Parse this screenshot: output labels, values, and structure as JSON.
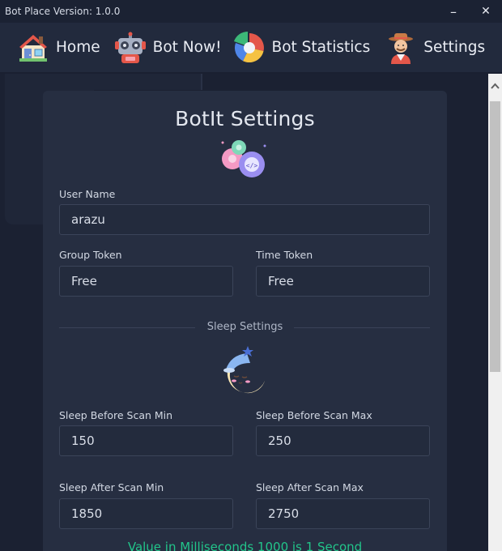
{
  "window": {
    "title": "Bot Place Version: 1.0.0",
    "minimize_glyph": "–",
    "close_glyph": "✕"
  },
  "nav": {
    "items": [
      {
        "label": "Home",
        "icon": "house-icon"
      },
      {
        "label": "Bot Now!",
        "icon": "robot-icon"
      },
      {
        "label": "Bot Statistics",
        "icon": "pie-chart-icon"
      },
      {
        "label": "Settings",
        "icon": "farmer-avatar-icon"
      }
    ]
  },
  "settings": {
    "title": "BotIt Settings",
    "user_name_label": "User Name",
    "user_name_value": "arazu",
    "group_token_label": "Group Token",
    "group_token_value": "Free",
    "time_token_label": "Time Token",
    "time_token_value": "Free",
    "sleep_section_label": "Sleep Settings",
    "sleep_before_min_label": "Sleep Before Scan Min",
    "sleep_before_min_value": "150",
    "sleep_before_max_label": "Sleep Before Scan Max",
    "sleep_before_max_value": "250",
    "sleep_after_min_label": "Sleep After Scan Min",
    "sleep_after_min_value": "1850",
    "sleep_after_max_label": "Sleep After Scan Max",
    "sleep_after_max_value": "2750",
    "note": "Value in Milliseconds 1000 is 1 Second"
  },
  "colors": {
    "background": "#1a2031",
    "navbar": "#222a3d",
    "card": "#262e41",
    "input_border": "#3b4459",
    "note_green": "#22c58a"
  }
}
